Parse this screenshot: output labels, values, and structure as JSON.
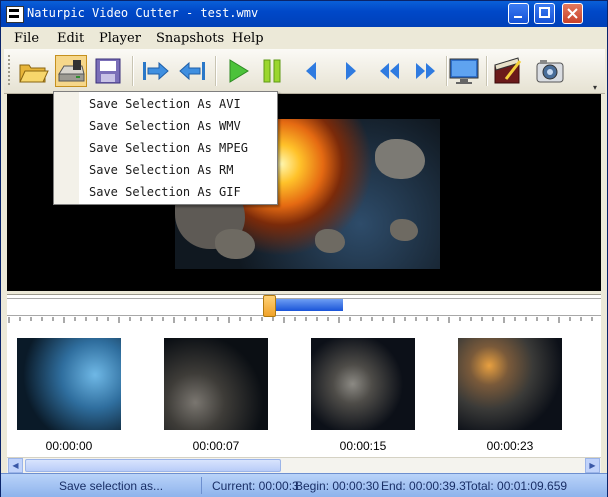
{
  "window": {
    "title": "Naturpic Video Cutter - test.wmv",
    "controls": [
      "minimize",
      "maximize",
      "close"
    ]
  },
  "menu": {
    "items": [
      "File",
      "Edit",
      "Player",
      "Snapshots",
      "Help"
    ]
  },
  "toolbar": {
    "buttons": [
      {
        "icon": "open-folder-icon"
      },
      {
        "icon": "save-selection-icon"
      },
      {
        "icon": "save-snapshot-icon"
      },
      {
        "icon": "save-disk-icon"
      },
      {
        "icon": "set-begin-icon"
      },
      {
        "icon": "set-end-icon"
      },
      {
        "icon": "play-icon"
      },
      {
        "icon": "pause-icon"
      },
      {
        "icon": "previous-frame-icon"
      },
      {
        "icon": "next-frame-icon"
      },
      {
        "icon": "rewind-icon"
      },
      {
        "icon": "fast-forward-icon"
      },
      {
        "icon": "monitor-icon"
      },
      {
        "icon": "clapper-icon"
      },
      {
        "icon": "camera-icon"
      }
    ]
  },
  "dropdown": {
    "items": [
      "Save Selection As AVI",
      "Save Selection As WMV",
      "Save Selection As MPEG",
      "Save Selection As RM",
      "Save Selection As GIF"
    ]
  },
  "timeline": {
    "selection_start_fraction": 0.44,
    "selection_end_fraction": 0.57
  },
  "thumbnails": [
    {
      "time": "00:00:00"
    },
    {
      "time": "00:00:07"
    },
    {
      "time": "00:00:15"
    },
    {
      "time": "00:00:23"
    }
  ],
  "status": {
    "message": "Save selection as...",
    "current": "Current: 00:00:3",
    "begin": "Begin: 00:00:30",
    "end": "End: 00:00:39.3",
    "total": "Total: 00:01:09.659"
  },
  "colors": {
    "titlebar": "#0048C8",
    "selection": "#1954D8",
    "statusbar": "#8EB3EC"
  }
}
